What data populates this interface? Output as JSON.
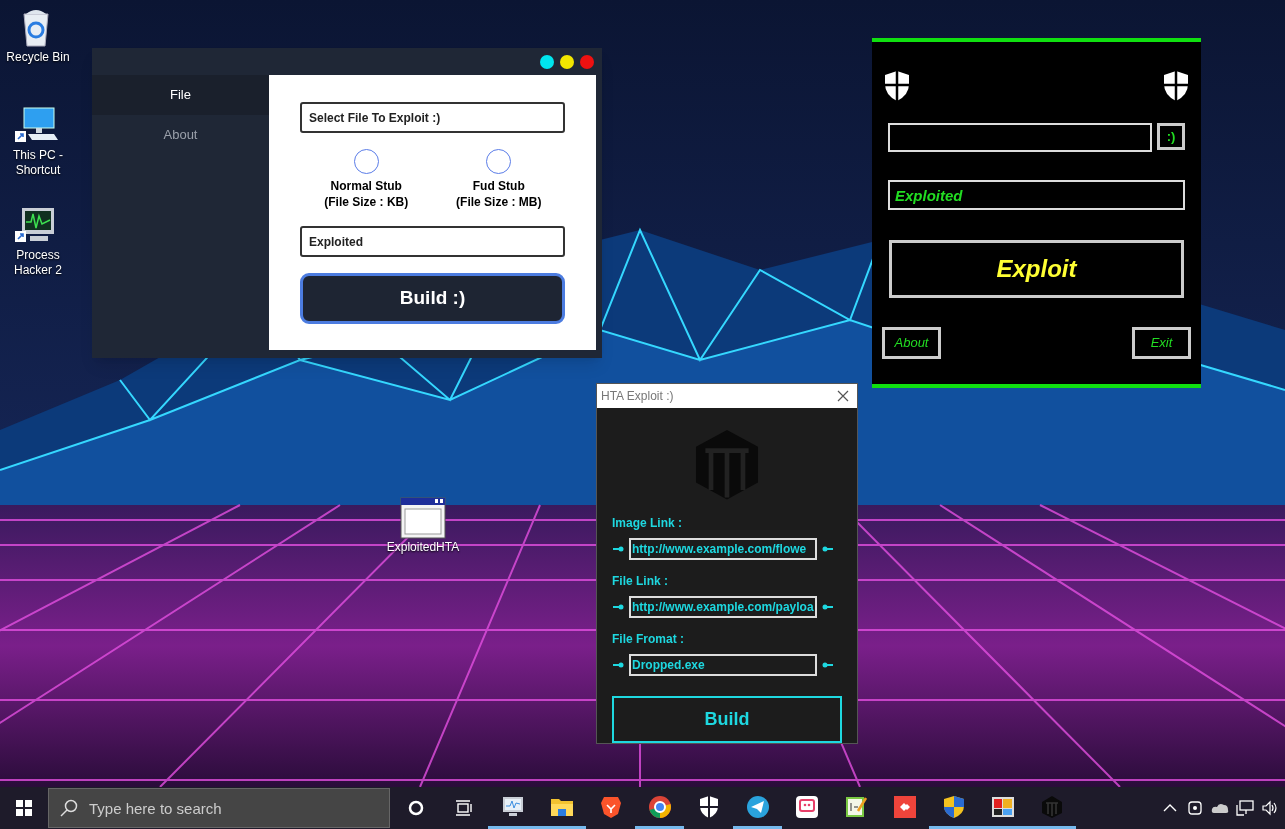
{
  "desktop_icons": [
    {
      "kind": "recycle",
      "label": "Recycle Bin"
    },
    {
      "kind": "pc",
      "label": "This PC - Shortcut",
      "shortcut": true
    },
    {
      "kind": "monitor",
      "label": "Process Hacker 2",
      "shortcut": true
    },
    {
      "kind": "hta",
      "label": "ExploitedHTA"
    }
  ],
  "builder_window": {
    "controls": [
      {
        "color": "#00e5ee"
      },
      {
        "color": "#f2e600"
      },
      {
        "color": "#ee1111"
      }
    ],
    "sidebar": {
      "items": [
        {
          "label": "File",
          "selected": true
        },
        {
          "label": "About",
          "selected": false
        }
      ]
    },
    "file_field": {
      "value": "Select File To Exploit :)"
    },
    "stubs": [
      {
        "label": "Normal Stub",
        "detail": "(File Size : KB)",
        "selected": false
      },
      {
        "label": "Fud Stub",
        "detail": "(File Size : MB)",
        "selected": false
      }
    ],
    "name_field": {
      "value": "Exploited"
    },
    "build_button": "Build :)"
  },
  "exploit_window": {
    "browse_button": ":)",
    "name_field": {
      "value": "Exploited"
    },
    "exploit_button": "Exploit",
    "about_button": "About",
    "exit_button": "Exit"
  },
  "hta_window": {
    "title": "HTA Exploit :)",
    "fields": [
      {
        "label": "Image Link :",
        "value": "http://www.example.com/flowe"
      },
      {
        "label": "File Link :",
        "value": "http://www.example.com/payloa"
      },
      {
        "label": "File Fromat :",
        "value": "Dropped.exe"
      }
    ],
    "build_button": "Build"
  },
  "taskbar": {
    "search": {
      "placeholder": "Type here to search"
    },
    "apps": [
      {
        "kind": "monitor",
        "running": true
      },
      {
        "kind": "folder",
        "running": true
      },
      {
        "kind": "lion",
        "running": false
      },
      {
        "kind": "chrome",
        "running": true
      },
      {
        "kind": "shield",
        "running": false
      },
      {
        "kind": "telegram",
        "running": true
      },
      {
        "kind": "chat",
        "running": false
      },
      {
        "kind": "notes",
        "running": false
      },
      {
        "kind": "diamond",
        "running": false
      },
      {
        "kind": "uac",
        "running": true
      },
      {
        "kind": "tiles",
        "running": true
      },
      {
        "kind": "hexagon",
        "running": true
      }
    ]
  }
}
